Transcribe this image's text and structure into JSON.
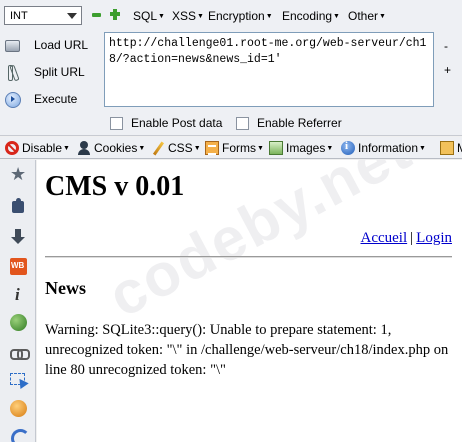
{
  "hackbar": {
    "db_select": "INT",
    "menus": [
      "SQL",
      "XSS",
      "Encryption",
      "Encoding",
      "Other"
    ],
    "actions": {
      "load_url": "Load URL",
      "split_url": "Split URL",
      "execute": "Execute"
    },
    "url_value": "http://challenge01.root-me.org/web-serveur/ch18/?action=news&news_id=1'",
    "side_minus": "-",
    "side_plus": "+",
    "post_data_label": "Enable Post data",
    "referrer_label": "Enable Referrer"
  },
  "webdev": {
    "items": [
      "Disable",
      "Cookies",
      "CSS",
      "Forms",
      "Images",
      "Information",
      "M"
    ]
  },
  "sidebar": {
    "icons": [
      "star-icon",
      "puzzle-icon",
      "download-arrow-icon",
      "wb-icon",
      "info-icon",
      "globe-icon",
      "chain-link-icon",
      "select-element-icon",
      "face-icon",
      "spiral-icon"
    ]
  },
  "page": {
    "title": "CMS v 0.01",
    "nav": {
      "home": "Accueil",
      "sep": "|",
      "login": "Login"
    },
    "section_title": "News",
    "warning": "Warning: SQLite3::query(): Unable to prepare statement: 1, unrecognized token: \"\\\" in /challenge/web-serveur/ch18/index.php on line 80 unrecognized token: \"\\\"",
    "watermark": "codeby.net"
  },
  "colors": {
    "accent_green": "#3c9e2e",
    "link": "#0000cc",
    "disable_red": "#d8261a"
  }
}
